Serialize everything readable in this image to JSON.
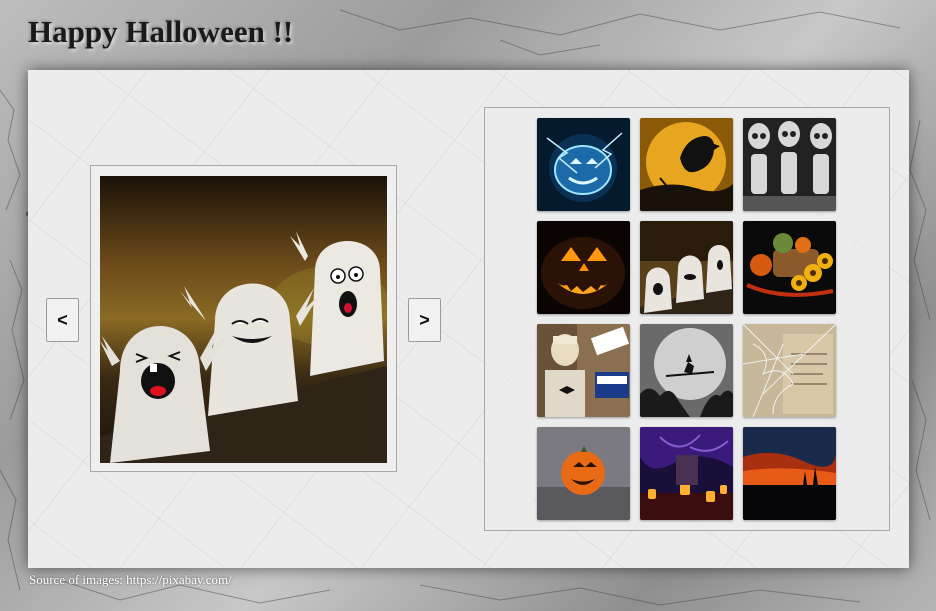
{
  "page": {
    "title": "Happy Halloween !!",
    "footer_text": "Source of images: https://pixabay.com/"
  },
  "viewer": {
    "prev_label": "<",
    "next_label": ">",
    "current_image": "three-ghost-figurines"
  },
  "gallery": {
    "thumbnails": [
      {
        "subject": "blue-lightning-pumpkin"
      },
      {
        "subject": "raven-full-moon"
      },
      {
        "subject": "three-skeletons"
      },
      {
        "subject": "jack-o-lantern-face"
      },
      {
        "subject": "three-ghost-figurines"
      },
      {
        "subject": "pumpkins-sunflowers"
      },
      {
        "subject": "skeleton-street-sign"
      },
      {
        "subject": "witch-flying-moon"
      },
      {
        "subject": "cobweb-old-book"
      },
      {
        "subject": "smiling-pumpkin-ball"
      },
      {
        "subject": "purple-graveyard-lanterns"
      },
      {
        "subject": "sunset-silhouette"
      }
    ]
  },
  "colors": {
    "panel": "#ececec",
    "title": "#1a1a1a",
    "footer": "#ffffff"
  }
}
